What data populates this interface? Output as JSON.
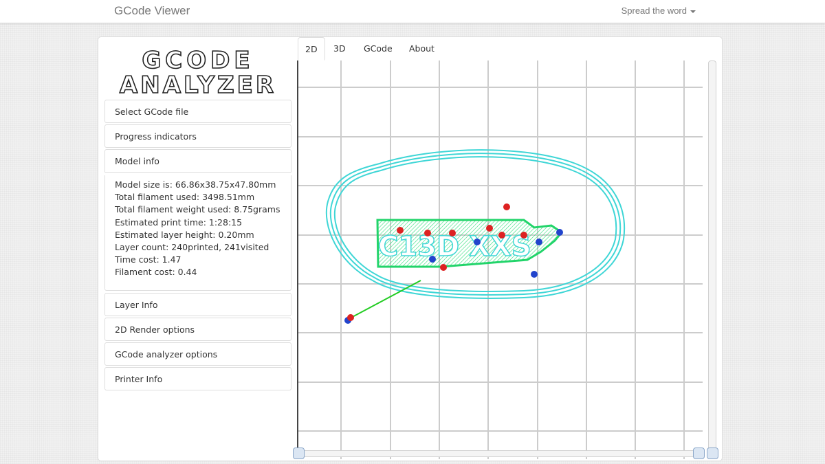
{
  "navbar": {
    "brand": "GCode Viewer",
    "spread_label": "Spread the word"
  },
  "logo": {
    "line1": "GCODE",
    "line2": "ANALYZER"
  },
  "sidebar": {
    "panels": [
      {
        "label": "Select GCode file"
      },
      {
        "label": "Progress indicators"
      },
      {
        "label": "Model info"
      },
      {
        "label": "Layer Info"
      },
      {
        "label": "2D Render options"
      },
      {
        "label": "GCode analyzer options"
      },
      {
        "label": "Printer Info"
      }
    ],
    "model_info": [
      "Model size is: 66.86x38.75x47.80mm",
      "Total filament used: 3498.51mm",
      "Total filament weight used: 8.75grams",
      "Estimated print time: 1:28:15",
      "Estimated layer height: 0.20mm",
      "Layer count: 240printed, 241visited",
      "Time cost: 1.47",
      "Filament cost: 0.44"
    ]
  },
  "tabs": [
    {
      "label": "2D",
      "active": true
    },
    {
      "label": "3D",
      "active": false
    },
    {
      "label": "GCode",
      "active": false
    },
    {
      "label": "About",
      "active": false
    }
  ],
  "render": {
    "text": "C13D XXS",
    "colors": {
      "grid": "#cccccc",
      "skirt": "#3fd6d6",
      "infill": "#2ee07a",
      "travel": "#22cc22",
      "retract": "#dd2222",
      "restart": "#2244cc"
    }
  },
  "colors": {
    "accent": "#428bca",
    "text": "#333333",
    "brand": "#777777"
  }
}
